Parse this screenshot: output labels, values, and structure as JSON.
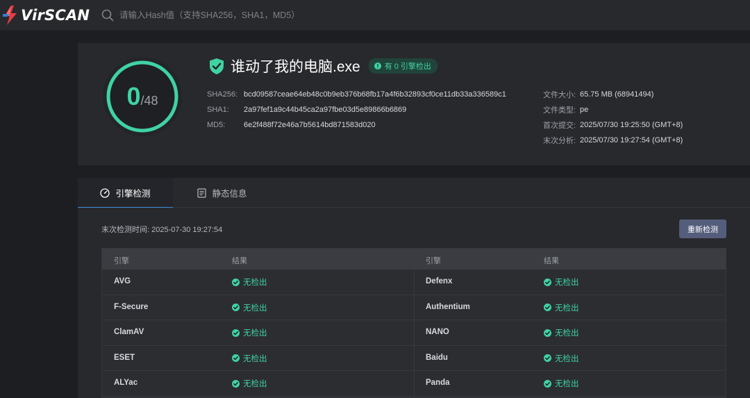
{
  "header": {
    "logo_text": "VirSCAN",
    "search_placeholder": "请输入Hash值（支持SHA256，SHA1，MD5）"
  },
  "score": {
    "detected": "0",
    "total": "/48"
  },
  "file": {
    "name": "谁动了我的电脑.exe",
    "badge": "有 0 引擎检出"
  },
  "hashes": [
    {
      "key": "SHA256:",
      "value": "bcd09587ceae64eb48c0b9eb376b68fb17a4f6b32893cf0ce11db33a336589c1"
    },
    {
      "key": "SHA1:",
      "value": "2a97fef1a9c44b45ca2a97fbe03d5e89866b6869"
    },
    {
      "key": "MD5:",
      "value": "6e2f488f72e46a7b5614bd871583d020"
    }
  ],
  "meta": [
    {
      "key": "文件大小:",
      "value": "65.75 MB (68941494)"
    },
    {
      "key": "文件类型:",
      "value": "pe"
    },
    {
      "key": "首次提交:",
      "value": "2025/07/30 19:25:50 (GMT+8)"
    },
    {
      "key": "末次分析:",
      "value": "2025/07/30 19:27:54 (GMT+8)"
    }
  ],
  "tabs": [
    {
      "label": "引擎检测",
      "active": true
    },
    {
      "label": "静态信息",
      "active": false
    }
  ],
  "panel": {
    "last_scan": "末次检测时间: 2025-07-30 19:27:54",
    "rescan_label": "重新检测"
  },
  "table": {
    "headers": [
      "引擎",
      "结果",
      "引擎",
      "结果"
    ],
    "rows": [
      {
        "left_engine": "AVG",
        "left_result": "无检出",
        "right_engine": "Defenx",
        "right_result": "无检出"
      },
      {
        "left_engine": "F-Secure",
        "left_result": "无检出",
        "right_engine": "Authentium",
        "right_result": "无检出"
      },
      {
        "left_engine": "ClamAV",
        "left_result": "无检出",
        "right_engine": "NANO",
        "right_result": "无检出"
      },
      {
        "left_engine": "ESET",
        "left_result": "无检出",
        "right_engine": "Baidu",
        "right_result": "无检出"
      },
      {
        "left_engine": "ALYac",
        "left_result": "无检出",
        "right_engine": "Panda",
        "right_result": "无检出"
      }
    ]
  },
  "colors": {
    "accent_green": "#3fd3a2",
    "tab_indicator": "#3e8fd6",
    "button_bg": "#545d7b",
    "page_bg": "#1d1e22",
    "card_bg": "#28292d"
  }
}
